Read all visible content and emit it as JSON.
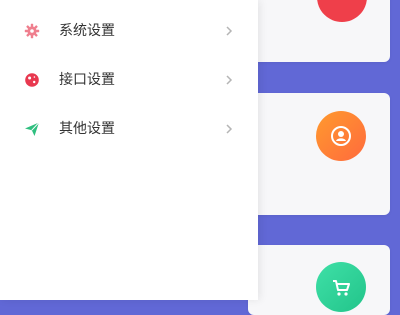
{
  "drawer": {
    "items": [
      {
        "label": "系统设置",
        "icon": "gear-icon",
        "color": "#ef7f8e"
      },
      {
        "label": "接口设置",
        "icon": "planet-icon",
        "color": "#e8384f"
      },
      {
        "label": "其他设置",
        "icon": "send-icon",
        "color": "#2fbf7f"
      }
    ]
  },
  "cards": [
    {
      "icon": "circle-icon",
      "color": "#ef3f4a"
    },
    {
      "icon": "user-icon",
      "color": "#ff8233"
    },
    {
      "icon": "cart-icon",
      "color": "#2cd293"
    }
  ],
  "colors": {
    "background": "#6168d6",
    "drawer": "#ffffff",
    "text": "#333333",
    "chevron": "#b5b5b5"
  }
}
